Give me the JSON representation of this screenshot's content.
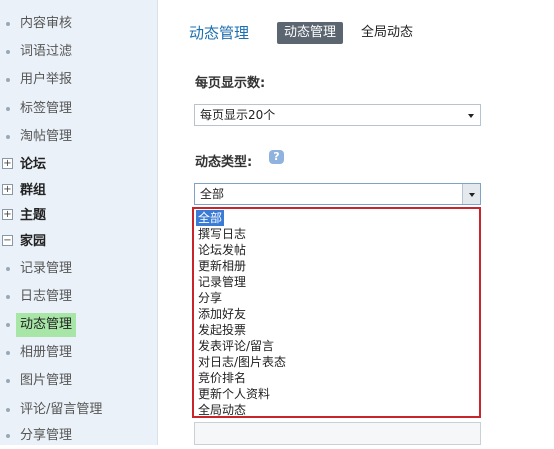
{
  "sidebar": {
    "items": [
      {
        "label": "内容审核"
      },
      {
        "label": "词语过滤"
      },
      {
        "label": "用户举报"
      },
      {
        "label": "标签管理"
      },
      {
        "label": "淘帖管理"
      },
      {
        "label": "论坛",
        "group": true,
        "state": "+"
      },
      {
        "label": "群组",
        "group": true,
        "state": "+"
      },
      {
        "label": "主题",
        "group": true,
        "state": "+"
      },
      {
        "label": "家园",
        "group": true,
        "state": "−"
      },
      {
        "label": "记录管理"
      },
      {
        "label": "日志管理"
      },
      {
        "label": "动态管理",
        "active": true
      },
      {
        "label": "相册管理"
      },
      {
        "label": "图片管理"
      },
      {
        "label": "评论/留言管理"
      },
      {
        "label": "分享管理"
      }
    ]
  },
  "header": {
    "title": "动态管理",
    "tabs": [
      {
        "label": "动态管理",
        "active": true
      },
      {
        "label": "全局动态"
      }
    ]
  },
  "form": {
    "per_page_label": "每页显示数:",
    "per_page_value": "每页显示20个",
    "type_label": "动态类型:",
    "type_value": "全部",
    "help_icon": "?"
  },
  "dropdown": {
    "options": [
      "全部",
      "撰写日志",
      "论坛发帖",
      "更新相册",
      "记录管理",
      "分享",
      "添加好友",
      "发起投票",
      "发表评论/留言",
      "对日志/图片表态",
      "竞价排名",
      "更新个人资料",
      "全局动态"
    ],
    "selected_index": 0
  },
  "colors": {
    "accent": "#1a6fb0",
    "highlight": "#c8242b",
    "active_nav": "#a8e6a8",
    "sidebar_bg": "#eaf1f8"
  }
}
